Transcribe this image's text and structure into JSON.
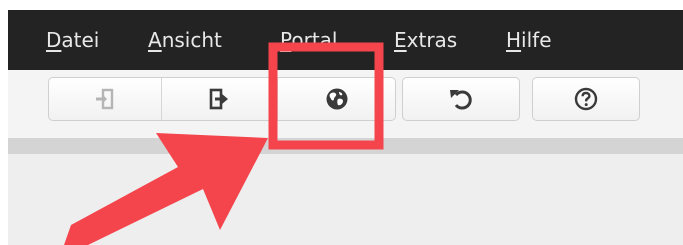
{
  "menubar": {
    "items": [
      {
        "label_underline": "D",
        "label_rest": "atei"
      },
      {
        "label_underline": "A",
        "label_rest": "nsicht"
      },
      {
        "label_underline": "P",
        "label_rest": "ortal"
      },
      {
        "label_underline": "E",
        "label_rest": "xtras"
      },
      {
        "label_underline": "H",
        "label_rest": "ilfe"
      }
    ]
  },
  "toolbar": {
    "buttons": [
      {
        "icon": "login-icon",
        "state": "disabled"
      },
      {
        "icon": "logout-icon",
        "state": "enabled"
      },
      {
        "icon": "globe-icon",
        "state": "enabled",
        "highlighted": true
      },
      {
        "icon": "refresh-icon",
        "state": "enabled"
      },
      {
        "icon": "help-icon",
        "state": "enabled"
      }
    ]
  },
  "colors": {
    "menubar_bg": "#232323",
    "menubar_text": "#e8e8e8",
    "annotation_red": "#f4454c",
    "icon_dark": "#3a3a3a",
    "icon_disabled": "#b5b5b5"
  }
}
